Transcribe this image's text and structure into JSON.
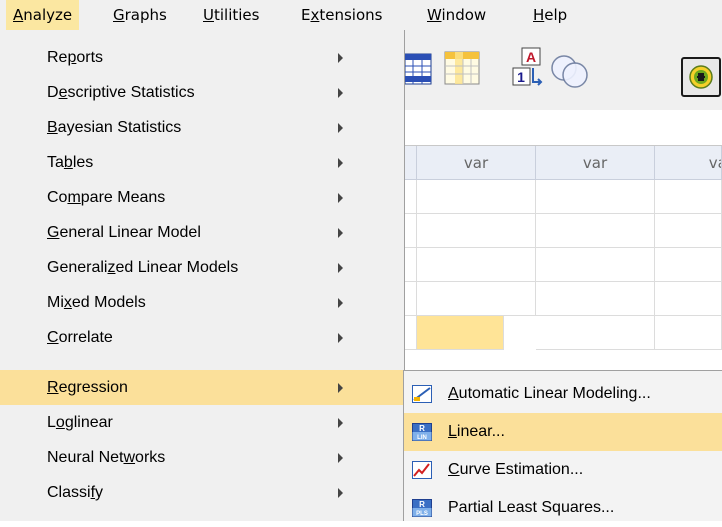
{
  "menubar": {
    "items": [
      {
        "pre": "",
        "key": "A",
        "post": "nalyze"
      },
      {
        "pre": "",
        "key": "G",
        "post": "raphs"
      },
      {
        "pre": "",
        "key": "U",
        "post": "tilities"
      },
      {
        "pre": "E",
        "key": "x",
        "post": "tensions"
      },
      {
        "pre": "",
        "key": "W",
        "post": "indow"
      },
      {
        "pre": "",
        "key": "H",
        "post": "elp"
      }
    ]
  },
  "analyze_menu": {
    "items": [
      {
        "pre": "Re",
        "key": "p",
        "post": "orts"
      },
      {
        "pre": "D",
        "key": "e",
        "post": "scriptive Statistics"
      },
      {
        "pre": "",
        "key": "B",
        "post": "ayesian Statistics"
      },
      {
        "pre": "Ta",
        "key": "b",
        "post": "les"
      },
      {
        "pre": "Co",
        "key": "m",
        "post": "pare Means"
      },
      {
        "pre": "",
        "key": "G",
        "post": "eneral Linear Model"
      },
      {
        "pre": "Generali",
        "key": "z",
        "post": "ed Linear Models"
      },
      {
        "pre": "Mi",
        "key": "x",
        "post": "ed Models"
      },
      {
        "pre": "",
        "key": "C",
        "post": "orrelate"
      },
      {
        "pre": "",
        "key": "R",
        "post": "egression"
      },
      {
        "pre": "L",
        "key": "o",
        "post": "glinear"
      },
      {
        "pre": "Neural Net",
        "key": "w",
        "post": "orks"
      },
      {
        "pre": "Classi",
        "key": "f",
        "post": "y"
      }
    ]
  },
  "regression_submenu": {
    "items": [
      {
        "pre": "",
        "key": "A",
        "post": "utomatic Linear Modeling...",
        "icon": "automatic-linear-modeling-icon"
      },
      {
        "pre": "",
        "key": "L",
        "post": "inear...",
        "icon": "linear-regression-icon"
      },
      {
        "pre": "",
        "key": "C",
        "post": "urve Estimation...",
        "icon": "curve-estimation-icon"
      },
      {
        "pre": "Partial Least Squares...",
        "key": "",
        "post": "",
        "icon": "partial-least-squares-icon"
      }
    ]
  },
  "toolbar": {
    "icons": [
      "insert-cases-icon",
      "insert-variable-icon",
      "value-labels-icon",
      "use-sets-icon",
      "spelling-icon"
    ],
    "value_labels_top": "A",
    "value_labels_bottom": "1"
  },
  "data_view": {
    "columns": [
      "var",
      "var",
      "var"
    ]
  },
  "colors": {
    "menu_highlight": "#fbe09a",
    "menubar_active": "#fbe7a1",
    "selected_cell": "#ffe497"
  }
}
